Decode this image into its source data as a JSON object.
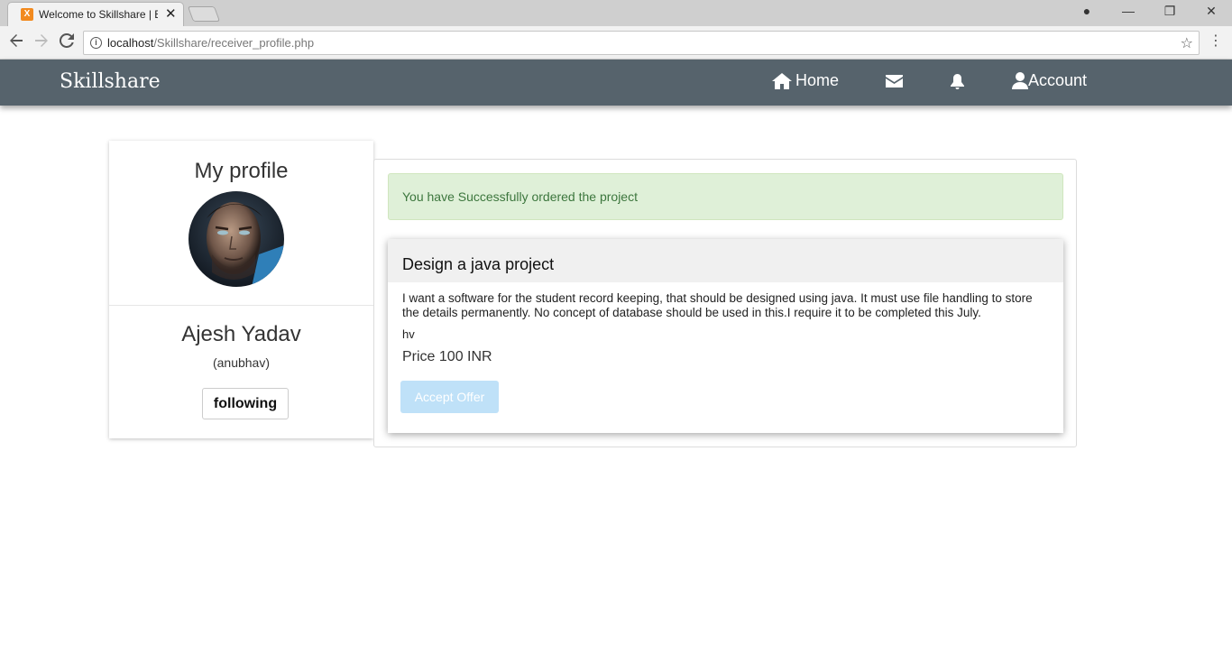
{
  "browser": {
    "tab_title": "Welcome to Skillshare | B",
    "url_host": "localhost",
    "url_path": "/Skillshare/receiver_profile.php"
  },
  "navbar": {
    "brand": "Skillshare",
    "home_label": "Home",
    "account_label": "Account"
  },
  "profile": {
    "title": "My profile",
    "name": "Ajesh Yadav",
    "username": "(anubhav)",
    "follow_button": "following"
  },
  "alert": {
    "message": "You have Successfully ordered the project",
    "color": "#dff0d8"
  },
  "project": {
    "title": "Design a java project",
    "description": "I want a software for the student record keeping, that should be designed using java. It must use file handling to store the details permanently. No concept of database should be used in this.I require it to be completed this July.",
    "note": "hv",
    "price": "Price 100 INR",
    "accept_button": "Accept Offer"
  },
  "colors": {
    "navbar": "#56636c",
    "accept_button": "#bfe1f8"
  },
  "icons": [
    "home-icon",
    "envelope-icon",
    "bell-icon",
    "user-icon"
  ]
}
